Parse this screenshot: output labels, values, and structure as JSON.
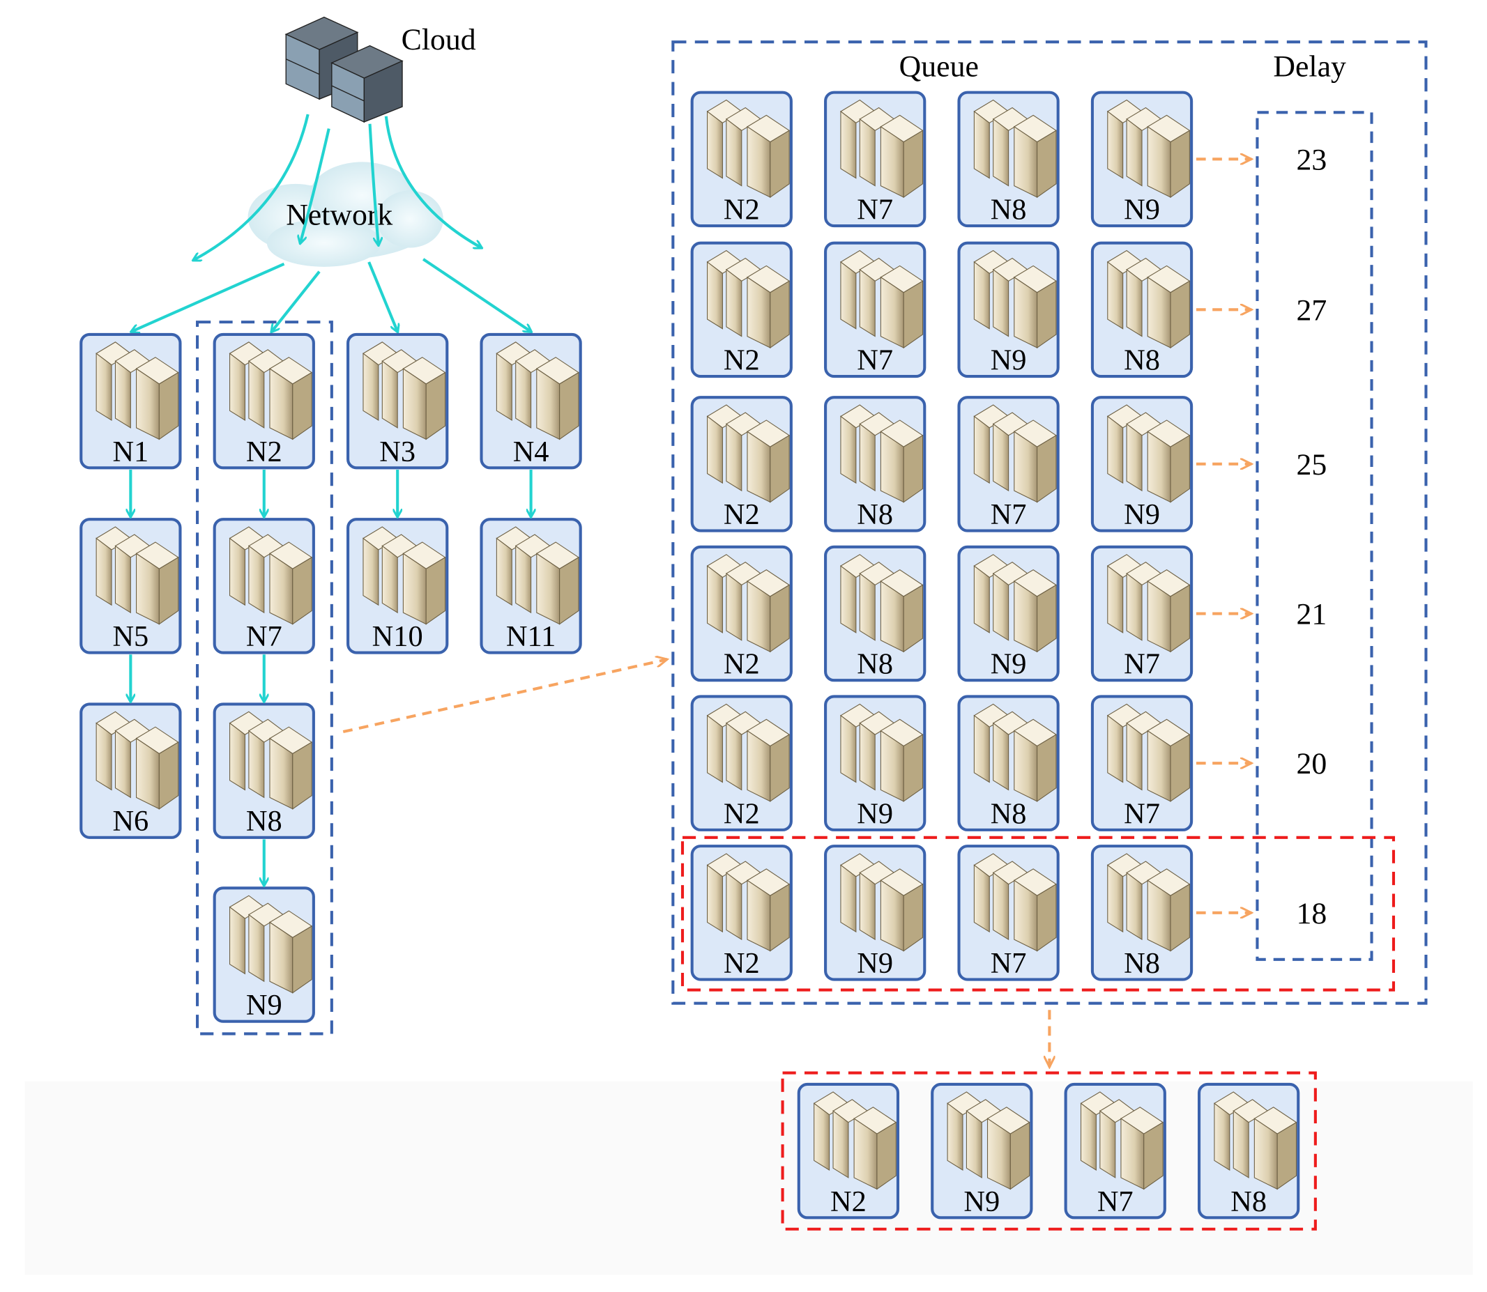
{
  "cloud_label": "Cloud",
  "network_label": "Network",
  "left_nodes": {
    "col1": [
      "N1",
      "N5",
      "N6"
    ],
    "col2": [
      "N2",
      "N7",
      "N8",
      "N9"
    ],
    "col3": [
      "N3",
      "N10"
    ],
    "col4": [
      "N4",
      "N11"
    ]
  },
  "queue": {
    "title": "Queue",
    "delay_title": "Delay",
    "rows": [
      {
        "nodes": [
          "N2",
          "N7",
          "N8",
          "N9"
        ],
        "delay": "23"
      },
      {
        "nodes": [
          "N2",
          "N7",
          "N9",
          "N8"
        ],
        "delay": "27"
      },
      {
        "nodes": [
          "N2",
          "N8",
          "N7",
          "N9"
        ],
        "delay": "25"
      },
      {
        "nodes": [
          "N2",
          "N8",
          "N9",
          "N7"
        ],
        "delay": "21"
      },
      {
        "nodes": [
          "N2",
          "N9",
          "N8",
          "N7"
        ],
        "delay": "20"
      },
      {
        "nodes": [
          "N2",
          "N9",
          "N7",
          "N8"
        ],
        "delay": "18"
      }
    ]
  },
  "result": {
    "nodes": [
      "N2",
      "N9",
      "N7",
      "N8"
    ]
  },
  "colors": {
    "node_fill": "#dce8f8",
    "node_stroke": "#3a62ad",
    "arrow_cyan": "#22d3d0",
    "arrow_orange": "#f7a460",
    "highlight_red": "#ee1c1c",
    "group_blue": "#3a62ad"
  }
}
